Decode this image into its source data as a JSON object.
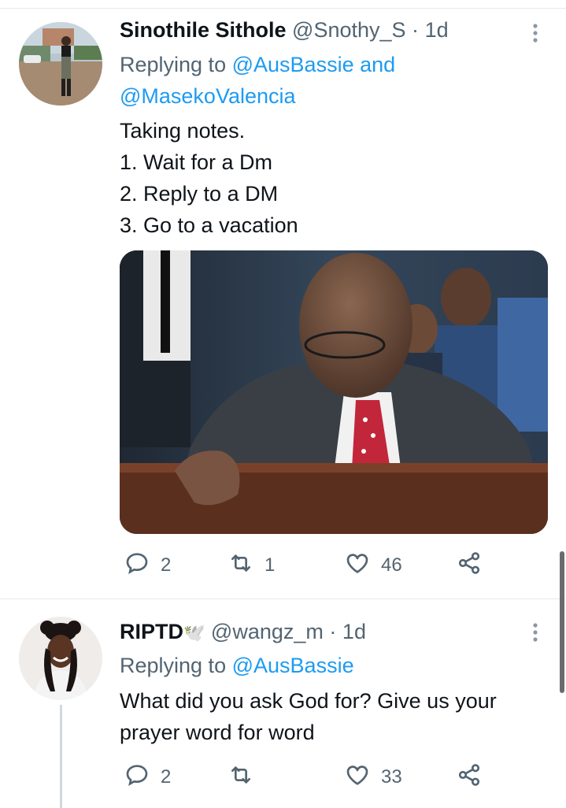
{
  "tweets": [
    {
      "name": "Sinothile Sithole",
      "handle": "@Snothy_S",
      "separator": "·",
      "time": "1d",
      "replying_prefix": "Replying to",
      "replying_to_1": "@AusBassie",
      "replying_and": "and",
      "replying_to_2": "@MasekoValencia",
      "body_lines": [
        "Taking notes.",
        "1. Wait for a Dm",
        "2. Reply to a DM",
        "3. Go to a vacation"
      ],
      "stats": {
        "replies": "2",
        "retweets": "1",
        "likes": "46"
      },
      "icons": {
        "more": "more-vertical-icon",
        "reply": "comment-icon",
        "retweet": "retweet-icon",
        "like": "heart-icon",
        "share": "share-icon"
      }
    },
    {
      "name": "RIPTD",
      "name_emoji": "🕊️",
      "handle": "@wangz_m",
      "separator": "·",
      "time": "1d",
      "replying_prefix": "Replying to",
      "replying_to_1": "@AusBassie",
      "body_lines": [
        "What did you ask God for? Give us your",
        "prayer word for word"
      ],
      "stats": {
        "replies": "2",
        "retweets": "",
        "likes": "33"
      },
      "icons": {
        "more": "more-vertical-icon",
        "reply": "comment-icon",
        "retweet": "retweet-icon",
        "like": "heart-icon",
        "share": "share-icon"
      }
    }
  ],
  "colors": {
    "link": "#1d9bf0",
    "secondary": "#536471",
    "text": "#0f1419",
    "divider": "#e7e9ea"
  }
}
